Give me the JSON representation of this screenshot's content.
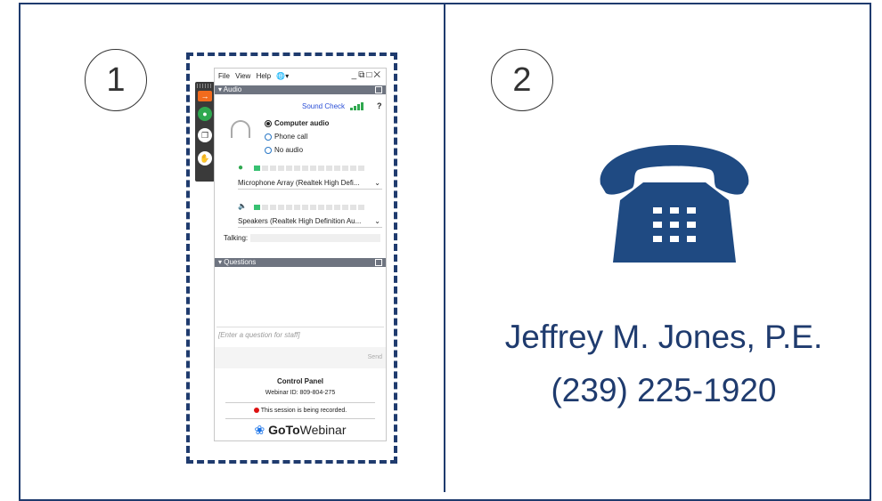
{
  "panel1": {
    "number": "1"
  },
  "panel2": {
    "number": "2"
  },
  "control_panel": {
    "menu": [
      "File",
      "View",
      "Help"
    ],
    "audio_section": "Audio",
    "sound_check": "Sound Check",
    "help": "?",
    "audio_options": [
      {
        "label": "Computer audio",
        "selected": true
      },
      {
        "label": "Phone call",
        "selected": false
      },
      {
        "label": "No audio",
        "selected": false
      }
    ],
    "microphone": "Microphone Array (Realtek High Defi...",
    "speakers": "Speakers (Realtek High Definition Au...",
    "talking_label": "Talking:",
    "questions_section": "Questions",
    "question_placeholder": "[Enter a question for staff]",
    "send_label": "Send",
    "footer_title": "Control Panel",
    "webinar_id": "Webinar ID: 809-804-275",
    "recording_notice": "This session is being recorded.",
    "brand_bold": "GoTo",
    "brand_regular": "Webinar"
  },
  "contact": {
    "name": "Jeffrey M. Jones, P.E.",
    "phone": "(239) 225-1920"
  },
  "colors": {
    "accent": "#1f3b6e",
    "phone_icon": "#1f4a82",
    "meter_on": "#38c172",
    "link": "#2b4fd6"
  }
}
